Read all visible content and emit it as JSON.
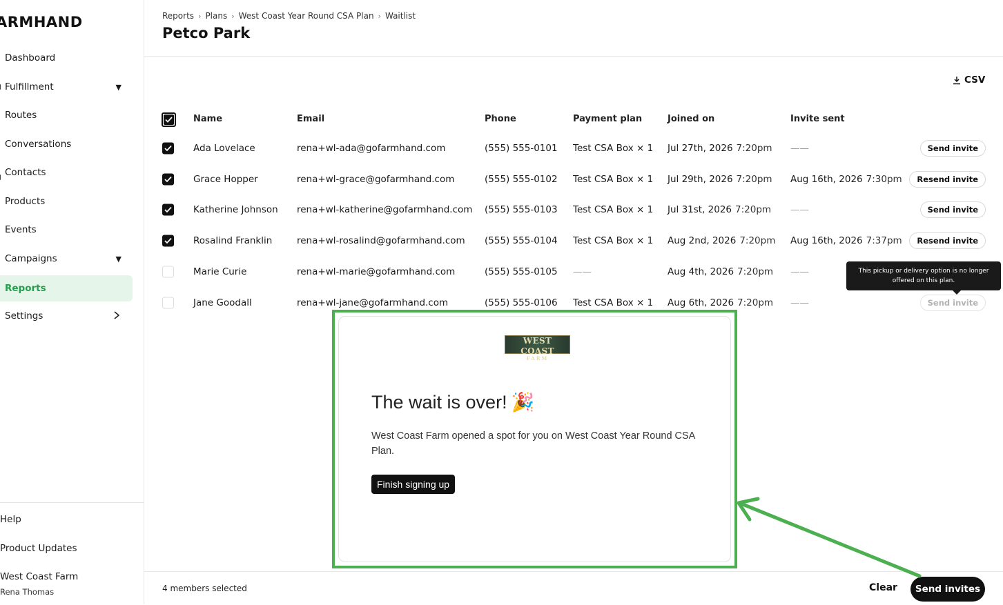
{
  "sidebar": {
    "logo": "ARMHAND",
    "items": [
      {
        "label": "Dashboard"
      },
      {
        "label": "Fulfillment"
      },
      {
        "label": "Routes"
      },
      {
        "label": "Conversations"
      },
      {
        "label": "Contacts"
      },
      {
        "label": "Products"
      },
      {
        "label": "Events"
      },
      {
        "label": "Campaigns"
      },
      {
        "label": "Reports"
      },
      {
        "label": "Settings"
      }
    ],
    "help": "Help",
    "product_updates": "Product Updates",
    "org_name": "West Coast Farm",
    "user_name": "Rena Thomas"
  },
  "header": {
    "breadcrumb": [
      "Reports",
      "Plans",
      "West Coast Year Round CSA Plan",
      "Waitlist"
    ],
    "title": "Petco Park"
  },
  "toolbar": {
    "csv_label": "CSV"
  },
  "table": {
    "columns": [
      "Name",
      "Email",
      "Phone",
      "Payment plan",
      "Joined on",
      "Invite sent"
    ],
    "rows": [
      {
        "name": "Ada Lovelace",
        "email": "rena+wl-ada@gofarmhand.com",
        "phone": "(555) 555-0101",
        "plan": "Test CSA Box × 1",
        "joined_date": "Jul 27th, 2026",
        "joined_time": "7:20pm",
        "invite_date": "——",
        "invite_time": "",
        "action": "Send invite"
      },
      {
        "name": "Grace Hopper",
        "email": "rena+wl-grace@gofarmhand.com",
        "phone": "(555) 555-0102",
        "plan": "Test CSA Box × 1",
        "joined_date": "Jul 29th, 2026",
        "joined_time": "7:20pm",
        "invite_date": "Aug 16th, 2026",
        "invite_time": "7:30pm",
        "action": "Resend invite"
      },
      {
        "name": "Katherine Johnson",
        "email": "rena+wl-katherine@gofarmhand.com",
        "phone": "(555) 555-0103",
        "plan": "Test CSA Box × 1",
        "joined_date": "Jul 31st, 2026",
        "joined_time": "7:20pm",
        "invite_date": "——",
        "invite_time": "",
        "action": "Send invite"
      },
      {
        "name": "Rosalind Franklin",
        "email": "rena+wl-rosalind@gofarmhand.com",
        "phone": "(555) 555-0104",
        "plan": "Test CSA Box × 1",
        "joined_date": "Aug 2nd, 2026",
        "joined_time": "7:20pm",
        "invite_date": "Aug 16th, 2026",
        "invite_time": "7:37pm",
        "action": "Resend invite"
      },
      {
        "name": "Marie Curie",
        "email": "rena+wl-marie@gofarmhand.com",
        "phone": "(555) 555-0105",
        "plan": "——",
        "joined_date": "Aug 4th, 2026",
        "joined_time": "7:20pm",
        "invite_date": "——",
        "invite_time": "",
        "action": ""
      },
      {
        "name": "Jane Goodall",
        "email": "rena+wl-jane@gofarmhand.com",
        "phone": "(555) 555-0106",
        "plan": "Test CSA Box × 1",
        "joined_date": "Aug 6th, 2026",
        "joined_time": "7:20pm",
        "invite_date": "——",
        "invite_time": "",
        "action": "Send invite"
      }
    ]
  },
  "tooltip": {
    "text": "This pickup or delivery option is no longer offered on this plan."
  },
  "email_preview": {
    "logo_text": "WEST COAST",
    "logo_sub": "FARM",
    "heading": "The wait is over!",
    "heading_emoji": "🎉",
    "body": "West Coast Farm opened a spot for you on West Coast Year Round CSA Plan.",
    "cta": "Finish signing up"
  },
  "footer": {
    "selected_count": "4 members selected",
    "clear_label": "Clear",
    "send_label": "Send invites"
  },
  "colors": {
    "accent_green": "#24a04b",
    "active_bg": "#e5f5ea",
    "highlight_green": "#4caf50",
    "primary_dark": "#111111"
  }
}
